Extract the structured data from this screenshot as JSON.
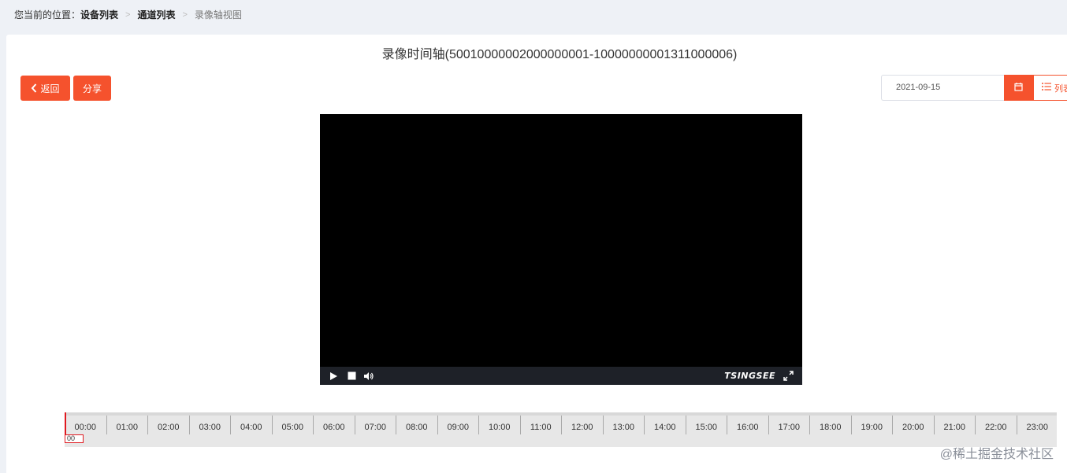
{
  "breadcrumb": {
    "prefix": "您当前的位置：",
    "items": [
      "设备列表",
      "通道列表",
      "录像轴视图"
    ]
  },
  "page": {
    "title": "录像时间轴(50010000002000000001-10000000001311000006)"
  },
  "toolbar": {
    "back_label": "返回",
    "share_label": "分享",
    "date_value": "2021-09-15",
    "list_label": "列表"
  },
  "player": {
    "brand": "TSINGSEE",
    "controls": [
      "play-icon",
      "stop-icon",
      "volume-icon",
      "fullscreen-icon"
    ]
  },
  "timeline": {
    "hours": [
      "00:00",
      "01:00",
      "02:00",
      "03:00",
      "04:00",
      "05:00",
      "06:00",
      "07:00",
      "08:00",
      "09:00",
      "10:00",
      "11:00",
      "12:00",
      "13:00",
      "14:00",
      "15:00",
      "16:00",
      "17:00",
      "18:00",
      "19:00",
      "20:00",
      "21:00",
      "22:00",
      "23:00"
    ],
    "cursor_label": "00"
  },
  "watermark": "@稀土掘金技术社区",
  "colors": {
    "accent": "#f5522d",
    "cursor": "#e0191f",
    "background": "#eef1f6"
  }
}
